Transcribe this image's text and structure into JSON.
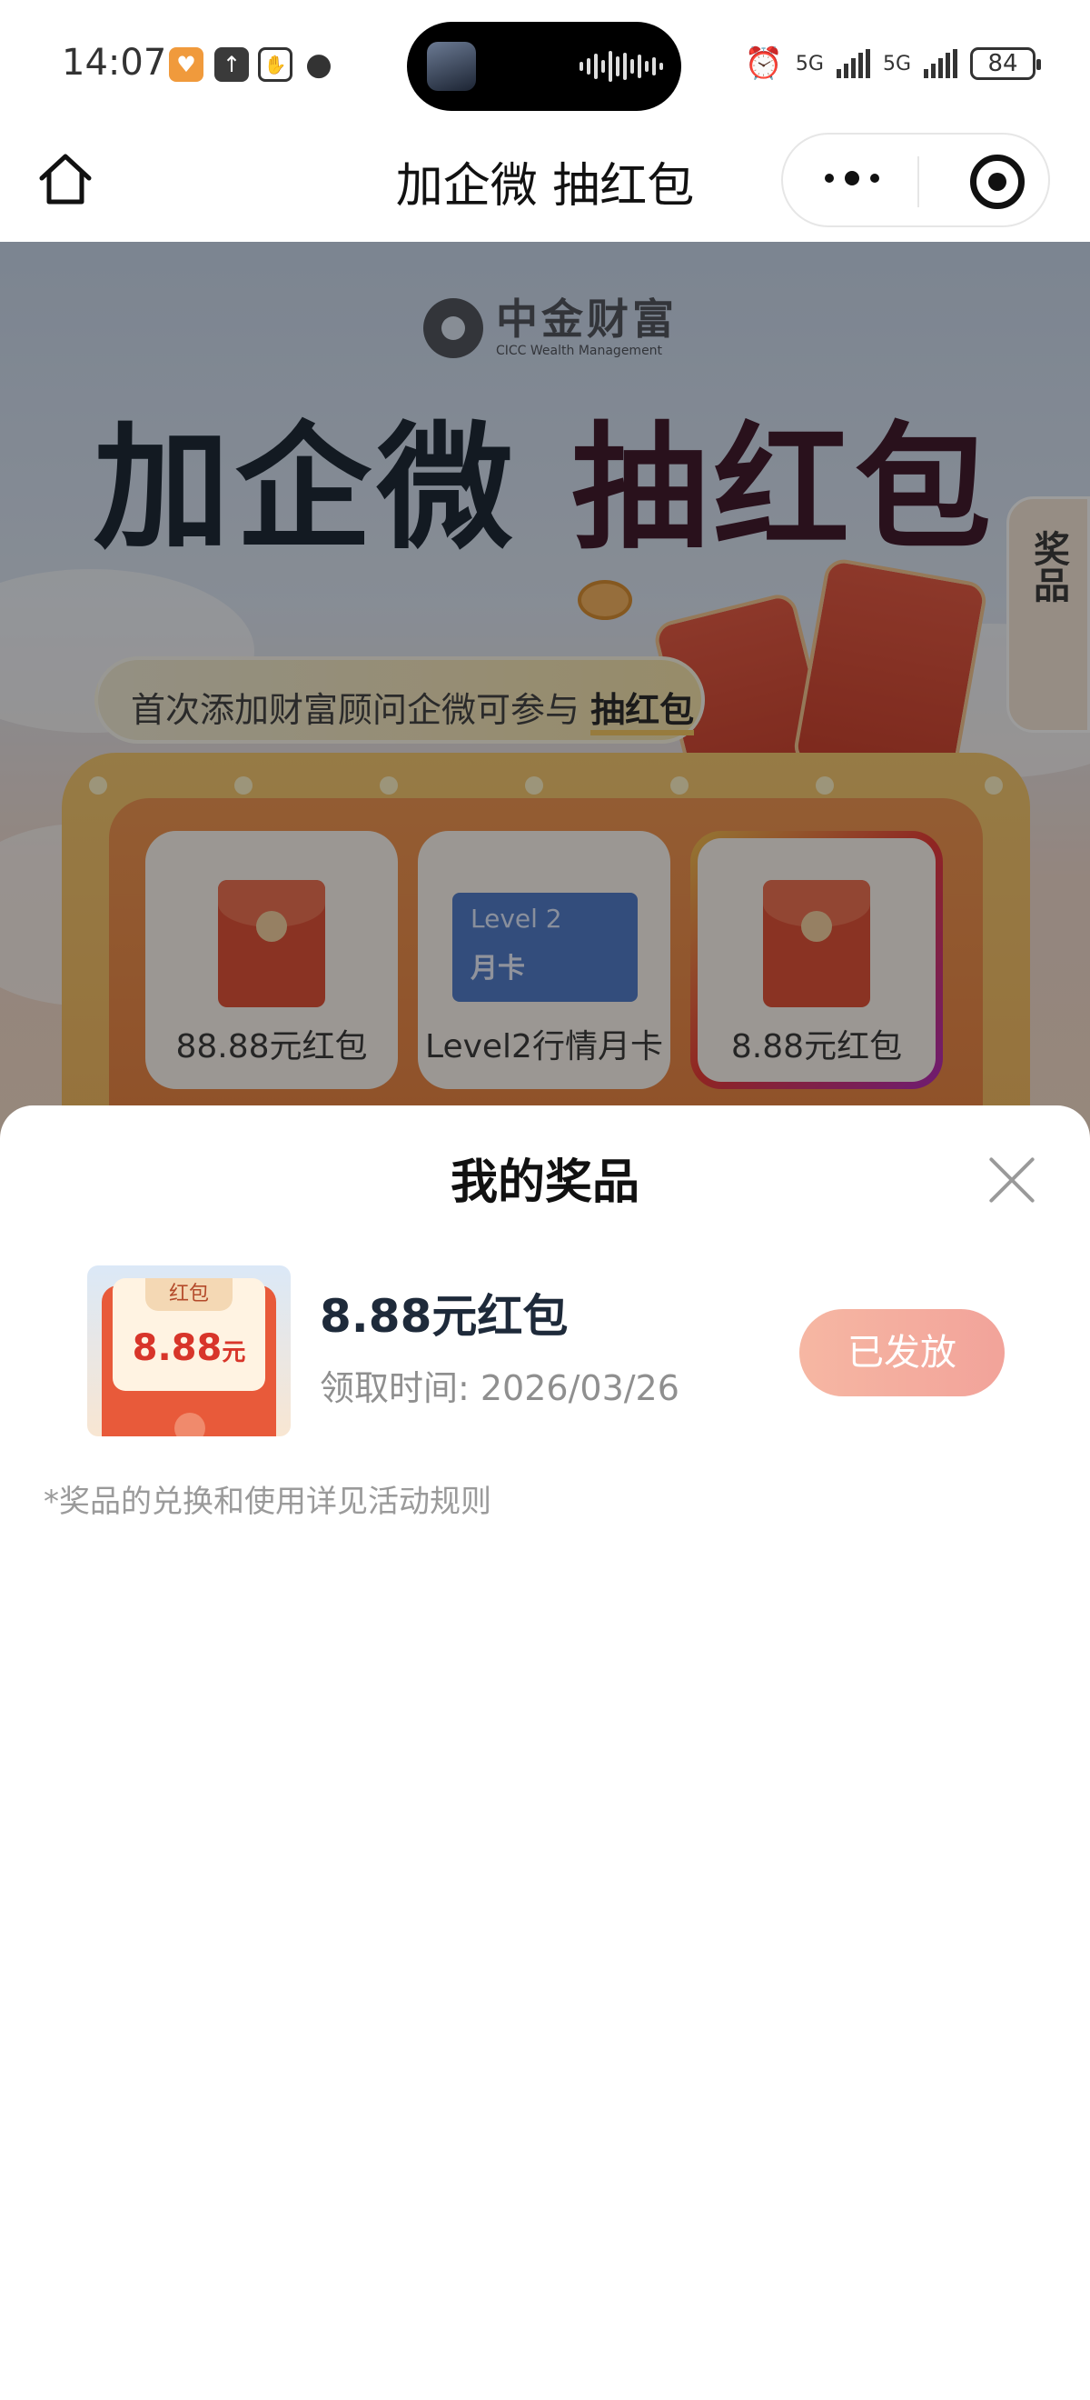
{
  "status_bar": {
    "time": "14:07",
    "network_1": "5G",
    "network_2": "5G",
    "battery": "84"
  },
  "nav": {
    "title": "加企微 抽红包"
  },
  "banner": {
    "brand_name": "中金财富",
    "brand_sub": "CICC Wealth Management",
    "title_main": "加企微 ",
    "title_tail": "抽红包",
    "side_tab": "奖品",
    "pill_text": "首次添加财富顾问企微可参与 ",
    "pill_bold": "抽红包",
    "prizes": [
      {
        "label": "88.88元红包"
      },
      {
        "label": "Level2行情月卡",
        "card_line1": "Level 2",
        "card_line2": "月卡"
      },
      {
        "label": "8.88元红包"
      }
    ]
  },
  "sheet": {
    "title": "我的奖品",
    "item": {
      "thumb_tag": "红包",
      "thumb_amount": "8.88",
      "thumb_unit": "元",
      "name": "8.88元红包",
      "time": "领取时间: 2026/03/26",
      "status": "已发放"
    },
    "note": "*奖品的兑换和使用详见活动规则"
  },
  "colors": {
    "accent": "#f2a39a",
    "title_dark": "#14202e",
    "red": "#e14a2f"
  }
}
